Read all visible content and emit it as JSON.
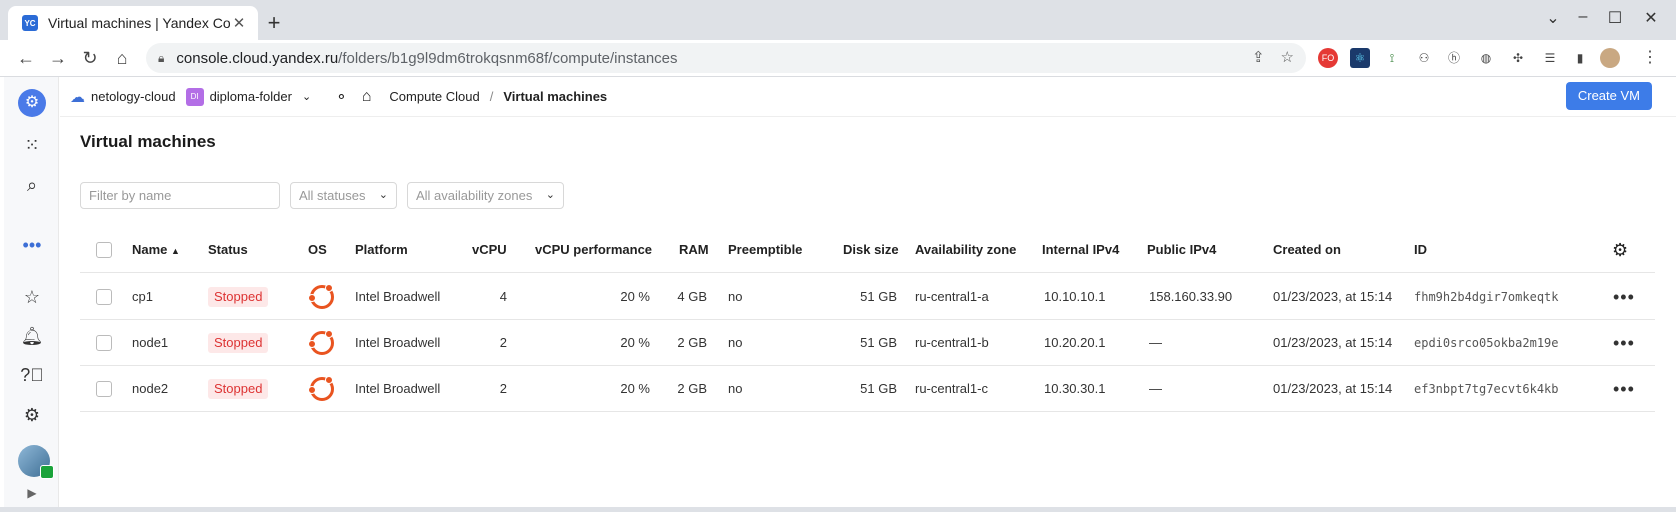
{
  "browser": {
    "favicon": "YC",
    "tab_title": "Virtual machines | Yandex Co",
    "url_host": "console.cloud.yandex.ru",
    "url_path": "/folders/b1g9l9dm6trokqsnm68f/compute/instances"
  },
  "header": {
    "cloud": "netology-cloud",
    "folder_badge": "DI",
    "folder": "diploma-folder",
    "service": "Compute Cloud",
    "sep": "/",
    "current": "Virtual machines",
    "create_button": "Create VM"
  },
  "page": {
    "title": "Virtual machines",
    "filter_placeholder": "Filter by name",
    "status_select": "All statuses",
    "zone_select": "All availability zones"
  },
  "table": {
    "columns": {
      "name": "Name",
      "status": "Status",
      "os": "OS",
      "platform": "Platform",
      "vcpu": "vCPU",
      "vcpu_perf": "vCPU performance",
      "ram": "RAM",
      "preemptible": "Preemptible",
      "disk": "Disk size",
      "zone": "Availability zone",
      "internal": "Internal IPv4",
      "public": "Public IPv4",
      "created": "Created on",
      "id": "ID"
    },
    "rows": [
      {
        "name": "cp1",
        "status": "Stopped",
        "os": "ubuntu-icon",
        "platform": "Intel Broadwell",
        "vcpu": "4",
        "vcpu_perf": "20 %",
        "ram": "4 GB",
        "preemptible": "no",
        "disk": "51 GB",
        "zone": "ru-central1-a",
        "internal": "10.10.10.1",
        "public": "158.160.33.90",
        "created": "01/23/2023, at 15:14",
        "id": "fhm9h2b4dgir7omkeqtk"
      },
      {
        "name": "node1",
        "status": "Stopped",
        "os": "ubuntu-icon",
        "platform": "Intel Broadwell",
        "vcpu": "2",
        "vcpu_perf": "20 %",
        "ram": "2 GB",
        "preemptible": "no",
        "disk": "51 GB",
        "zone": "ru-central1-b",
        "internal": "10.20.20.1",
        "public": "—",
        "created": "01/23/2023, at 15:14",
        "id": "epdi0srco05okba2m19e"
      },
      {
        "name": "node2",
        "status": "Stopped",
        "os": "ubuntu-icon",
        "platform": "Intel Broadwell",
        "vcpu": "2",
        "vcpu_perf": "20 %",
        "ram": "2 GB",
        "preemptible": "no",
        "disk": "51 GB",
        "zone": "ru-central1-c",
        "internal": "10.30.30.1",
        "public": "—",
        "created": "01/23/2023, at 15:14",
        "id": "ef3nbpt7tg7ecvt6k4kb"
      }
    ]
  },
  "colors": {
    "accent": "#3d7ce8",
    "stopped": "#d33333",
    "ubuntu": "#e95420"
  }
}
